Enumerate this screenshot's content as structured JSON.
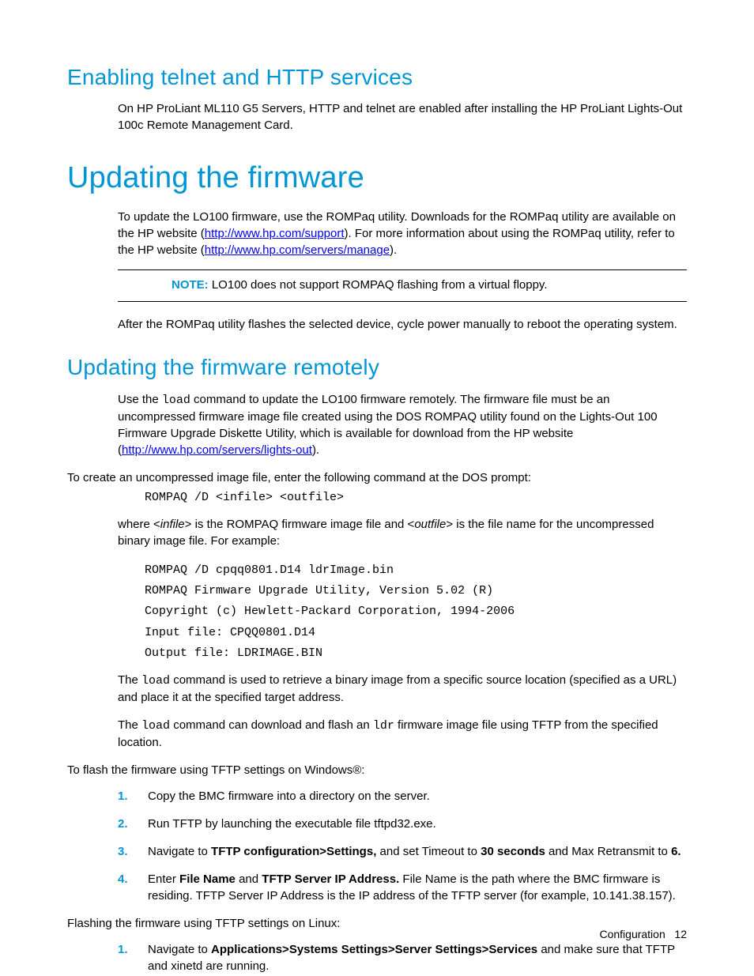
{
  "section1": {
    "title": "Enabling telnet and HTTP services",
    "para": "On HP ProLiant ML110 G5 Servers, HTTP and telnet are enabled after installing the HP ProLiant Lights-Out 100c Remote Management Card."
  },
  "section2": {
    "title": "Updating the firmware",
    "p1_a": "To update the LO100 firmware, use the ROMPaq utility. Downloads for the ROMPaq utility are available on the HP website (",
    "link1": "http://www.hp.com/support",
    "p1_b": "). For more information about using the ROMPaq utility, refer to the HP website (",
    "link2": "http://www.hp.com/servers/manage",
    "p1_c": ").",
    "note_label": "NOTE:",
    "note_text": "  LO100 does not support ROMPAQ flashing from a virtual floppy.",
    "p2": "After the ROMPaq utility flashes the selected device, cycle power manually to reboot the operating system."
  },
  "section3": {
    "title": "Updating the firmware remotely",
    "p1_a": "Use the ",
    "p1_code": "load",
    "p1_b": " command to update the LO100 firmware remotely. The firmware file must be an uncompressed firmware image file created using the DOS ROMPAQ utility found on the Lights-Out 100 Firmware Upgrade Diskette Utility, which is available for download from the HP website (",
    "link1": "http://www.hp.com/servers/lights-out",
    "p1_c": ").",
    "p2": "To create an uncompressed image file, enter the following command at the DOS prompt:",
    "code1": "ROMPAQ /D <infile> <outfile>",
    "p3_a": "where <",
    "p3_i1": "infile",
    "p3_b": "> is the ROMPAQ firmware image file and <",
    "p3_i2": "outfile",
    "p3_c": "> is the file name for the uncompressed binary image file. For example:",
    "code2_l1": "ROMPAQ /D cpqq0801.D14 ldrImage.bin",
    "code2_l2": "ROMPAQ Firmware Upgrade Utility, Version 5.02 (R)",
    "code2_l3": "Copyright (c) Hewlett-Packard Corporation, 1994-2006",
    "code2_l4": "Input file:   CPQQ0801.D14",
    "code2_l5": "Output file:  LDRIMAGE.BIN",
    "p4_a": "The ",
    "p4_code": "load",
    "p4_b": " command is used to retrieve a binary image from a specific source location (specified as a URL) and place it at the specified target address.",
    "p5_a": "The ",
    "p5_code1": "load",
    "p5_b": " command can download and flash an ",
    "p5_code2": "ldr",
    "p5_c": " firmware image file using TFTP from the specified location.",
    "p6": "To flash the firmware using TFTP settings on Windows®:",
    "win_steps": {
      "n1": "1.",
      "s1": "Copy the BMC firmware into a directory on the server.",
      "n2": "2.",
      "s2": "Run TFTP by launching the executable file tftpd32.exe.",
      "n3": "3.",
      "s3_a": "Navigate to ",
      "s3_b1": "TFTP configuration>Settings,",
      "s3_c": " and set Timeout to ",
      "s3_b2": "30 seconds",
      "s3_d": " and Max Retransmit to ",
      "s3_b3": "6.",
      "n4": "4.",
      "s4_a": "Enter ",
      "s4_b1": "File Name",
      "s4_b": " and ",
      "s4_b2": "TFTP Server IP Address.",
      "s4_c": " File Name is the path where the BMC firmware is residing. TFTP Server IP Address is the IP address of the TFTP server (for example, 10.141.38.157)."
    },
    "p7": "Flashing the firmware using TFTP settings on Linux:",
    "linux_steps": {
      "n1": "1.",
      "s1_a": "Navigate to ",
      "s1_b": "Applications>Systems Settings>Server Settings>Services",
      "s1_c": " and make sure that TFTP and xinetd are running."
    }
  },
  "footer": {
    "label": "Configuration",
    "page": "12"
  }
}
